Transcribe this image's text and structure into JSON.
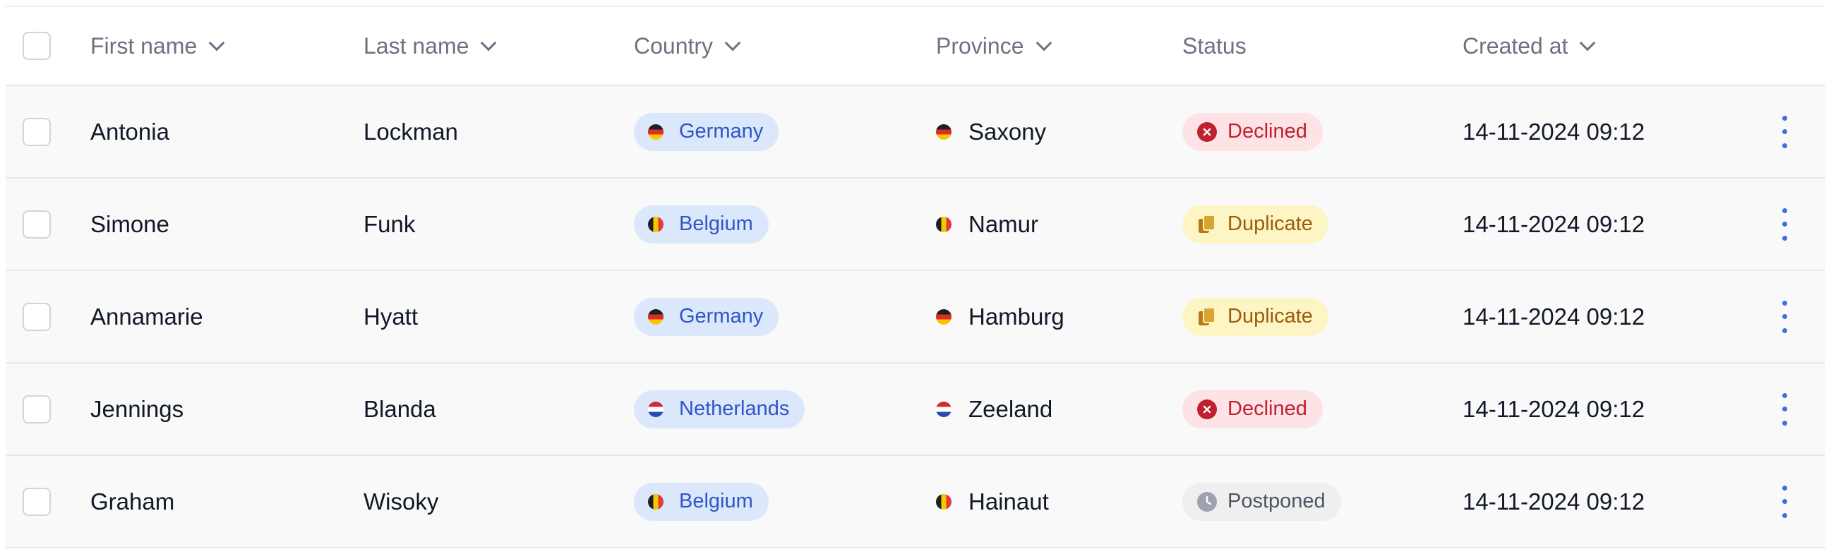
{
  "columns": {
    "first_name": "First name",
    "last_name": "Last name",
    "country": "Country",
    "province": "Province",
    "status": "Status",
    "created_at": "Created at"
  },
  "header_icons": {
    "select_all": "checkbox-empty",
    "sort": "chevron-down-icon"
  },
  "rows": [
    {
      "first_name": "Antonia",
      "last_name": "Lockman",
      "country": "Germany",
      "province": "Saxony",
      "status": "Declined",
      "status_icon": "x-circle-icon",
      "created_at": "14-11-2024 09:12"
    },
    {
      "first_name": "Simone",
      "last_name": "Funk",
      "country": "Belgium",
      "province": "Namur",
      "status": "Duplicate",
      "status_icon": "copy-icon",
      "created_at": "14-11-2024 09:12"
    },
    {
      "first_name": "Annamarie",
      "last_name": "Hyatt",
      "country": "Germany",
      "province": "Hamburg",
      "status": "Duplicate",
      "status_icon": "copy-icon",
      "created_at": "14-11-2024 09:12"
    },
    {
      "first_name": "Jennings",
      "last_name": "Blanda",
      "country": "Netherlands",
      "province": "Zeeland",
      "status": "Declined",
      "status_icon": "x-circle-icon",
      "created_at": "14-11-2024 09:12"
    },
    {
      "first_name": "Graham",
      "last_name": "Wisoky",
      "country": "Belgium",
      "province": "Hainaut",
      "status": "Postponed",
      "status_icon": "clock-icon",
      "created_at": "14-11-2024 09:12"
    }
  ],
  "colors": {
    "country_pill_bg": "#dbe8fb",
    "country_pill_text": "#2f55c8",
    "declined_bg": "#fde3e6",
    "declined_text": "#c0212f",
    "duplicate_bg": "#fdf5c4",
    "duplicate_text": "#9c5c0c",
    "postponed_bg": "#efeff0",
    "postponed_text": "#4b5563",
    "row_menu": "#3b6fe0"
  }
}
